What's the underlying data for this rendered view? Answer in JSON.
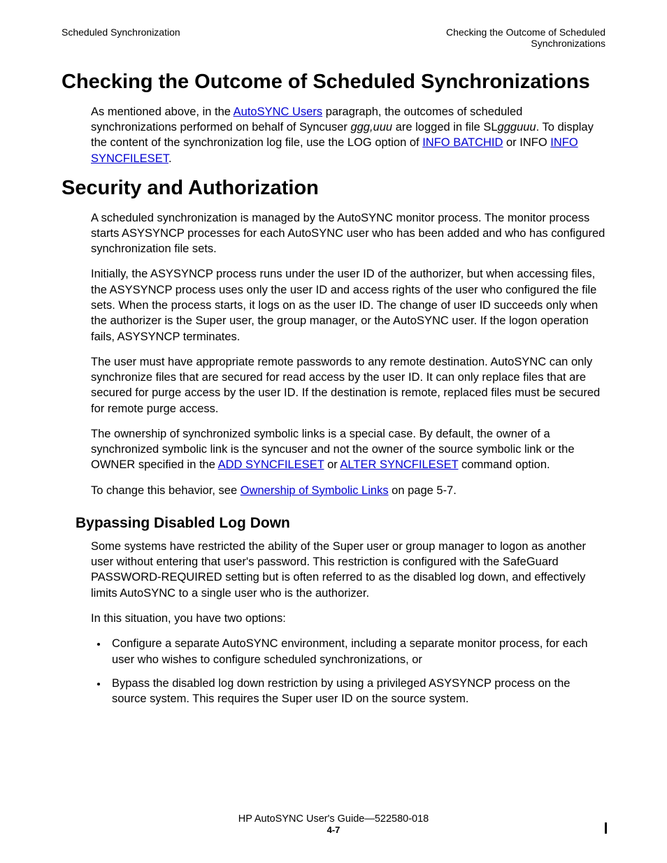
{
  "header": {
    "left": "Scheduled Synchronization",
    "right1": "Checking the Outcome of Scheduled",
    "right2": "Synchronizations"
  },
  "h1": "Checking the Outcome of Scheduled Synchronizations",
  "p1a": "As mentioned above, in the ",
  "p1_link1": "AutoSYNC Users",
  "p1b": " paragraph, the outcomes of scheduled synchronizations performed on behalf of Syncuser ",
  "p1_ital1": "ggg,uuu",
  "p1c": " are logged in file SL",
  "p1_ital2": "ggguuu",
  "p1d": ". To display the content of the synchronization log file, use the LOG option of ",
  "p1_link2": "INFO BATCHID",
  "p1e": " or INFO ",
  "p1_link3": "INFO SYNCFILESET",
  "p1f": ".",
  "h1b": "Security and Authorization",
  "p2": "A scheduled synchronization is managed by the AutoSYNC monitor process. The monitor process starts ASYSYNCP processes for each AutoSYNC user who has been added and who has configured synchronization file sets.",
  "p3": "Initially, the ASYSYNCP process runs under the user ID of the authorizer, but when accessing files, the ASYSYNCP process uses only the user ID and access rights of the user who configured the file sets. When the process starts, it logs on as the user ID. The change of user ID succeeds only when the authorizer is the Super user, the group manager, or the AutoSYNC user. If the logon operation fails, ASYSYNCP terminates.",
  "p4": "The user must have appropriate remote passwords to any remote destination. AutoSYNC can only synchronize files that are secured for read access by the user ID. It can only replace files that are secured for purge access by the user ID. If the destination is remote, replaced files must be secured for remote purge access.",
  "p5a": "The ownership of synchronized symbolic links is a special case. By default, the owner of a synchronized symbolic link is the syncuser and not the owner of the source symbolic link or the OWNER specified in the ",
  "p5_link1": "ADD SYNCFILESET",
  "p5b": " or ",
  "p5_link2": "ALTER SYNCFILESET",
  "p5c": " command option.",
  "p6a": "To change this behavior, see ",
  "p6_link1": "Ownership of Symbolic Links",
  "p6b": " on page 5-7.",
  "h2": "Bypassing Disabled Log Down",
  "p7": "Some systems have restricted the ability of the Super user or group manager to logon as another user without entering that user's password. This restriction is configured with the SafeGuard PASSWORD-REQUIRED setting but is often referred to as the disabled log down, and effectively limits AutoSYNC to a single user who is the authorizer.",
  "p8": "In this situation, you have two options:",
  "li1": "Configure a separate AutoSYNC environment, including a separate monitor process, for each user who wishes to configure scheduled synchronizations, or",
  "li2": "Bypass the disabled log down restriction by using a privileged ASYSYNCP process on the source system. This requires the Super user ID on the source system.",
  "footer": {
    "line": "HP AutoSYNC User's Guide—522580-018",
    "pnum": "4-7"
  }
}
